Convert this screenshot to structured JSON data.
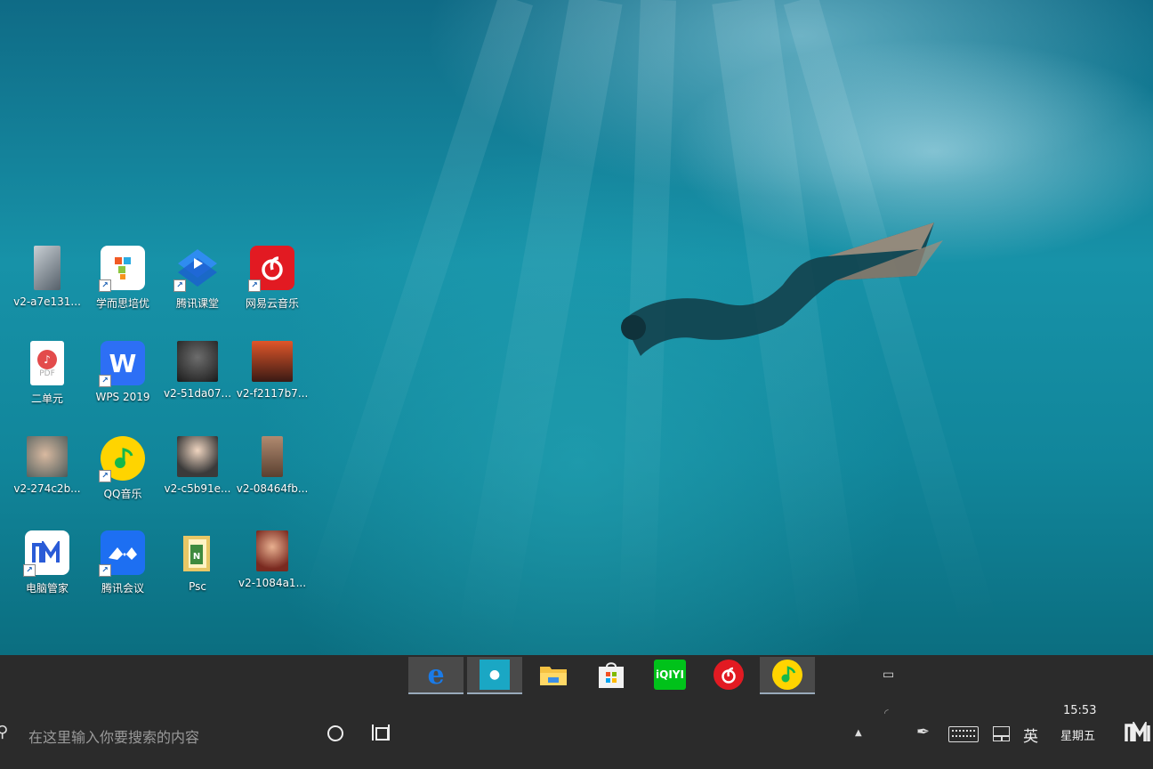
{
  "desktop": {
    "icons": [
      {
        "label": "v2-a7e131..."
      },
      {
        "label": "学而思培优"
      },
      {
        "label": "腾讯课堂"
      },
      {
        "label": "网易云音乐"
      },
      {
        "label": "二单元"
      },
      {
        "label": "WPS 2019"
      },
      {
        "label": "v2-51da07..."
      },
      {
        "label": "v2-f2117b7..."
      },
      {
        "label": "v2-274c2b..."
      },
      {
        "label": "QQ音乐"
      },
      {
        "label": "v2-c5b91e..."
      },
      {
        "label": "v2-08464fb..."
      },
      {
        "label": "电脑管家"
      },
      {
        "label": "腾讯会议"
      },
      {
        "label": "Psc"
      },
      {
        "label": "v2-1084a1..."
      }
    ],
    "pdf_badge": "PDF",
    "wps_glyph": "W",
    "iqiyi_text": "iQIYI"
  },
  "taskbar": {
    "search_placeholder": "在这里输入你要搜索的内容",
    "apps": [
      "edge-icon",
      "qq-icon",
      "file-explorer-icon",
      "store-icon",
      "iqiyi-icon",
      "netease-music-icon",
      "qq-music-icon"
    ],
    "tray": {
      "ime": "英",
      "time": "15:53",
      "weekday": "星期五"
    }
  }
}
